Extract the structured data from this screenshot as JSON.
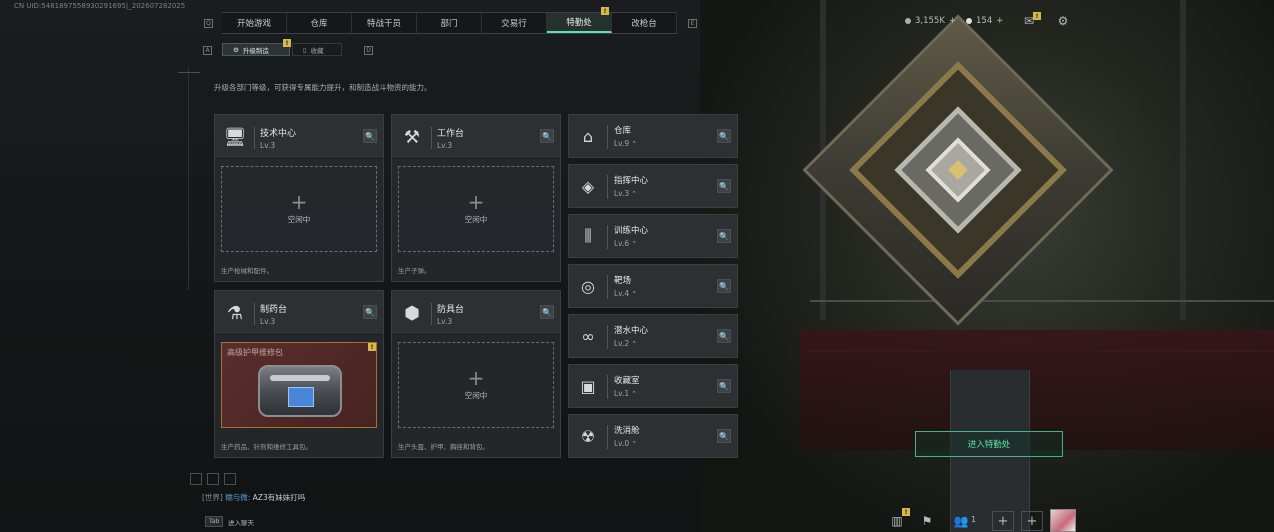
{
  "device_id": "CN UID:5481897558930291695|_202607282025",
  "nav": {
    "tabs": [
      {
        "label": "开始游戏",
        "active": false
      },
      {
        "label": "仓库",
        "active": false
      },
      {
        "label": "特战干员",
        "active": false
      },
      {
        "label": "部门",
        "active": false
      },
      {
        "label": "交易行",
        "active": false
      },
      {
        "label": "特勤处",
        "active": true,
        "badge": "!"
      },
      {
        "label": "改枪台",
        "active": false
      }
    ],
    "left_key": "Q",
    "right_key": "E"
  },
  "currency": {
    "coins": "3,155K",
    "gems": "154"
  },
  "subnav": {
    "left_key": "A",
    "right_key": "D",
    "tabs": [
      {
        "label": "升级制造",
        "active": true,
        "badge": "!"
      },
      {
        "label": "收藏",
        "active": false
      }
    ]
  },
  "description": "升级各部门等级，可获得专属能力提升，和制造战斗物资的能力。",
  "departments": [
    {
      "title": "技术中心",
      "level": "Lv.3",
      "slot_label": "空闲中",
      "footer": "生产枪械和配件。",
      "icon": "monitor-icon"
    },
    {
      "title": "工作台",
      "level": "Lv.3",
      "slot_label": "空闲中",
      "footer": "生产子弹。",
      "icon": "tools-icon"
    },
    {
      "title": "制药台",
      "level": "Lv.3",
      "item_name": "高级护甲维修包",
      "footer": "生产药品、针剂和维修工具包。",
      "icon": "microscope-icon",
      "badge": "!"
    },
    {
      "title": "防具台",
      "level": "Lv.3",
      "slot_label": "空闲中",
      "footer": "生产头盔、护甲、胸挂和背包。",
      "icon": "armor-icon"
    }
  ],
  "facilities": [
    {
      "title": "仓库",
      "level": "Lv.9",
      "icon": "warehouse-icon"
    },
    {
      "title": "指挥中心",
      "level": "Lv.3",
      "icon": "command-icon"
    },
    {
      "title": "训练中心",
      "level": "Lv.6",
      "icon": "dumbbell-icon"
    },
    {
      "title": "靶场",
      "level": "Lv.4",
      "icon": "target-icon"
    },
    {
      "title": "潜水中心",
      "level": "Lv.2",
      "icon": "goggles-icon"
    },
    {
      "title": "收藏室",
      "level": "Lv.1",
      "icon": "collection-icon"
    },
    {
      "title": "洗消舱",
      "level": "Lv.0",
      "icon": "decon-icon"
    }
  ],
  "enter_button": "进入特勤处",
  "chat": {
    "channel": "[世界]",
    "user": "糯与微:",
    "message": "AZ3有妹妹打吗",
    "tab_key": "Tab",
    "tab_label": "进入聊天"
  },
  "bottom": {
    "friends_count": "1",
    "badge": "!"
  },
  "colors": {
    "accent": "#5fe0a8",
    "badge": "#d8b84a",
    "level_up": "#d9b84e"
  }
}
